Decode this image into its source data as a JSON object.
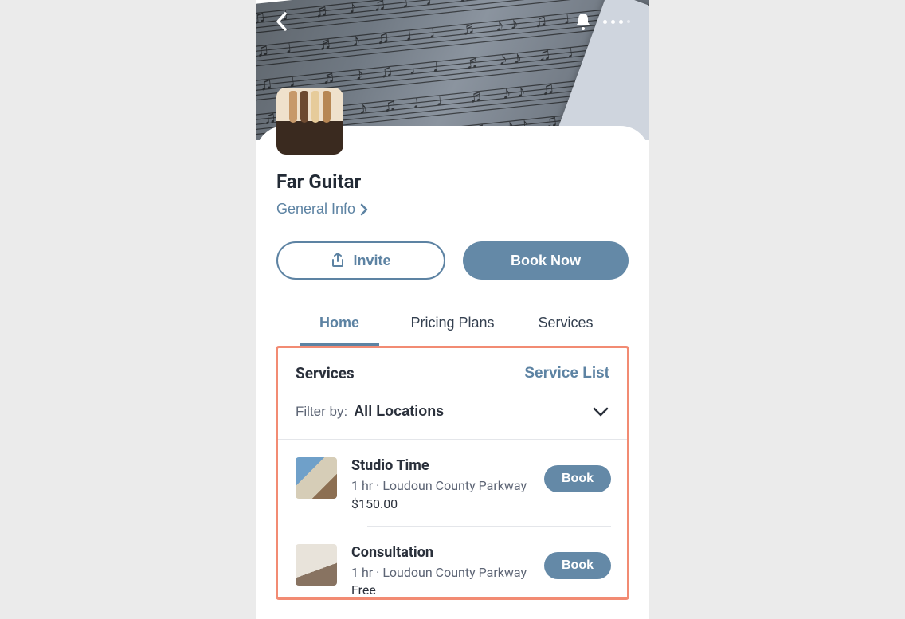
{
  "header": {
    "icons": {
      "back": "back-chevron-icon",
      "bell": "bell-icon",
      "more": "more-dots-icon"
    }
  },
  "profile": {
    "title": "Far Guitar",
    "info_link": "General Info"
  },
  "actions": {
    "invite_label": "Invite",
    "book_now_label": "Book Now"
  },
  "tabs": [
    {
      "label": "Home",
      "active": true
    },
    {
      "label": "Pricing Plans",
      "active": false
    },
    {
      "label": "Services",
      "active": false
    }
  ],
  "services_panel": {
    "heading": "Services",
    "list_link": "Service List",
    "filter_label": "Filter by:",
    "filter_value": "All Locations",
    "items": [
      {
        "name": "Studio Time",
        "meta": "1 hr · Loudoun County Parkway",
        "price": "$150.00",
        "cta": "Book"
      },
      {
        "name": "Consultation",
        "meta": "1 hr · Loudoun County Parkway",
        "price": "Free",
        "cta": "Book"
      }
    ]
  }
}
